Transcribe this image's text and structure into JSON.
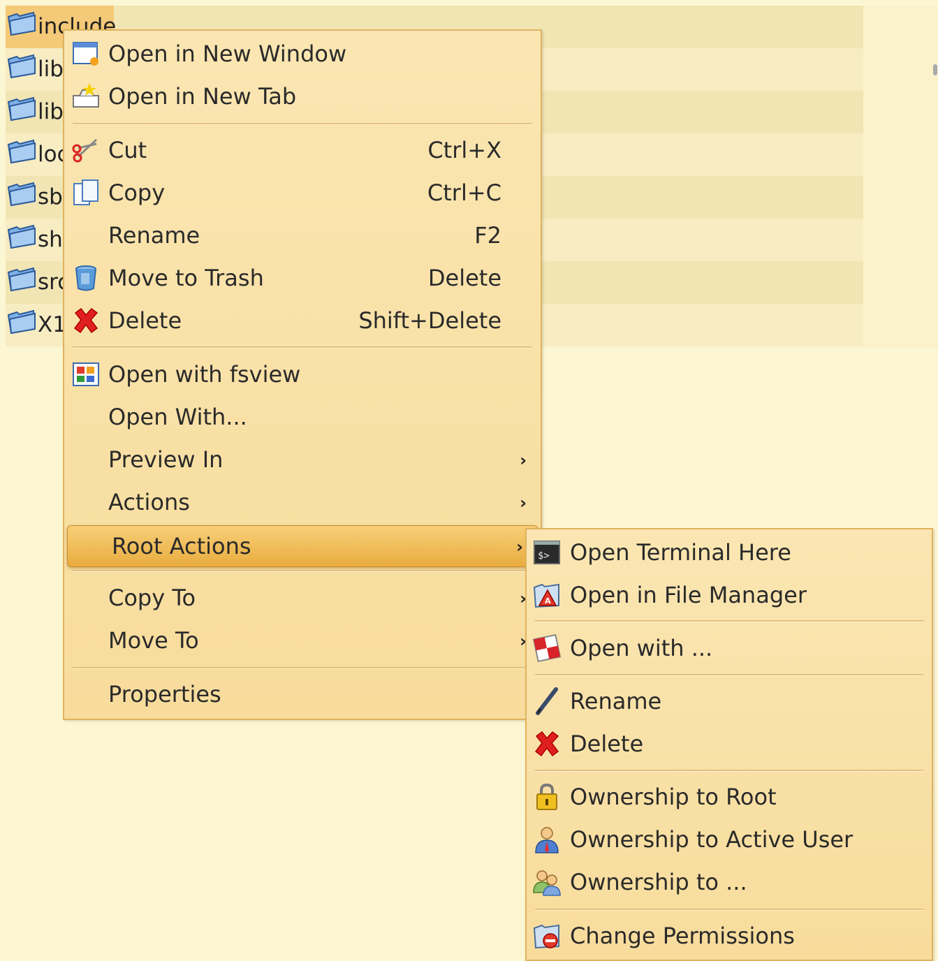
{
  "file_list": {
    "items": [
      {
        "label": "include",
        "selected": true
      },
      {
        "label": "lib"
      },
      {
        "label": "lib"
      },
      {
        "label": "loc"
      },
      {
        "label": "sb"
      },
      {
        "label": "sh"
      },
      {
        "label": "src"
      },
      {
        "label": "X1"
      }
    ]
  },
  "context_menu": {
    "items": [
      {
        "label": "Open in New Window",
        "icon": "new-window-icon"
      },
      {
        "label": "Open in New Tab",
        "icon": "new-tab-icon"
      },
      {
        "label": "Cut",
        "shortcut": "Ctrl+X",
        "icon": "scissors-icon"
      },
      {
        "label": "Copy",
        "shortcut": "Ctrl+C",
        "icon": "copy-icon"
      },
      {
        "label": "Rename",
        "shortcut": "F2"
      },
      {
        "label": "Move to Trash",
        "shortcut": "Delete",
        "icon": "trash-icon"
      },
      {
        "label": "Delete",
        "shortcut": "Shift+Delete",
        "icon": "red-x-icon"
      },
      {
        "label": "Open with fsview",
        "icon": "fsview-icon"
      },
      {
        "label": "Open With..."
      },
      {
        "label": "Preview In",
        "submenu": true
      },
      {
        "label": "Actions",
        "submenu": true
      },
      {
        "label": "Root Actions",
        "submenu": true,
        "highlighted": true
      },
      {
        "label": "Copy To",
        "submenu": true
      },
      {
        "label": "Move To",
        "submenu": true
      },
      {
        "label": "Properties"
      }
    ],
    "submenu_arrow": "›"
  },
  "root_actions_menu": {
    "items": [
      {
        "label": "Open Terminal Here",
        "icon": "terminal-icon"
      },
      {
        "label": "Open in File Manager",
        "icon": "file-manager-icon"
      },
      {
        "label": "Open with ...",
        "icon": "open-with-icon"
      },
      {
        "label": "Rename",
        "icon": "pencil-icon"
      },
      {
        "label": "Delete",
        "icon": "red-x-icon"
      },
      {
        "label": "Ownership to Root",
        "icon": "lock-icon"
      },
      {
        "label": "Ownership to Active User",
        "icon": "user-icon"
      },
      {
        "label": "Ownership to ...",
        "icon": "users-icon"
      },
      {
        "label": "Change Permissions",
        "icon": "permissions-icon"
      }
    ]
  },
  "colors": {
    "menu_bg": "#f9e2a8",
    "highlight": "#eeb655",
    "page_bg": "#fdf6d2"
  }
}
